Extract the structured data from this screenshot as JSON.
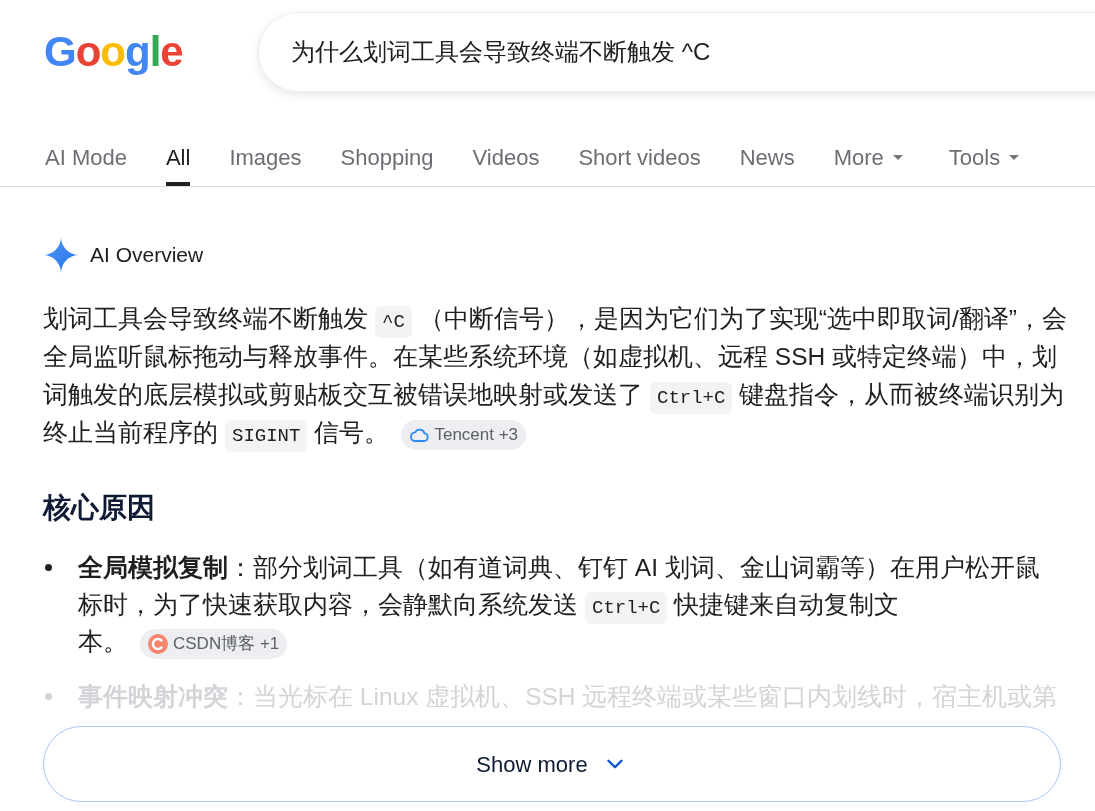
{
  "logo": {
    "text": "Google"
  },
  "search": {
    "value": "为什么划词工具会导致终端不断触发 ^C"
  },
  "tabs": [
    {
      "label": "AI Mode",
      "kind": "tab",
      "selected": false
    },
    {
      "label": "All",
      "kind": "tab",
      "selected": true
    },
    {
      "label": "Images",
      "kind": "tab",
      "selected": false
    },
    {
      "label": "Shopping",
      "kind": "tab",
      "selected": false
    },
    {
      "label": "Videos",
      "kind": "tab",
      "selected": false
    },
    {
      "label": "Short videos",
      "kind": "tab",
      "selected": false
    },
    {
      "label": "News",
      "kind": "tab",
      "selected": false
    },
    {
      "label": "More",
      "kind": "menu",
      "selected": false
    }
  ],
  "tools": {
    "label": "Tools"
  },
  "ai_overview": {
    "title": "AI Overview",
    "summary": {
      "lines": [
        [
          {
            "kind": "text",
            "text": "划词工具会导致终端不断触发"
          },
          {
            "kind": "code",
            "text": "^C"
          },
          {
            "kind": "text",
            "text": "（中断信号），是因为它们为了实现“选中即取词/翻译”，会"
          }
        ],
        [
          {
            "kind": "text",
            "text": "全局监听鼠标拖动与释放事件。在某些系统环境（如虚拟机、远程 SSH 或特定终端）中，划"
          }
        ],
        [
          {
            "kind": "text",
            "text": "词触发的底层模拟或剪贴板交互被错误地映射或发送了"
          },
          {
            "kind": "code",
            "text": "Ctrl+C"
          },
          {
            "kind": "text",
            "text": "键盘指令，从而被终端识别为"
          }
        ],
        [
          {
            "kind": "text",
            "text": "终止当前程序的"
          },
          {
            "kind": "code",
            "text": "SIGINT"
          },
          {
            "kind": "text",
            "text": "信号。"
          },
          {
            "kind": "source",
            "label": "Tencent +3"
          }
        ]
      ]
    },
    "heading": "核心原因",
    "points": [
      {
        "faded": false,
        "lines": [
          [
            {
              "kind": "text",
              "text": "**全局模拟复制**：部分划词工具（如有道词典、钉钉 AI 划词、金山词霸等）在用户松开鼠"
            }
          ],
          [
            {
              "kind": "text",
              "text": "标时，为了快速获取内容，会静默向系统发送"
            },
            {
              "kind": "code",
              "text": "Ctrl+C"
            },
            {
              "kind": "text",
              "text": "快捷键来自动复制文"
            }
          ],
          [
            {
              "kind": "text",
              "text": "本。"
            },
            {
              "kind": "source",
              "label": "CSDN博客 +1"
            }
          ]
        ]
      },
      {
        "faded": true,
        "lines": [
          [
            {
              "kind": "text",
              "text": "**事件映射冲突**：当光标在 Linux 虚拟机、SSH 远程终端或某些窗口内划线时，宿主机或第"
            }
          ]
        ]
      }
    ]
  },
  "show_more": {
    "label": "Show more"
  }
}
